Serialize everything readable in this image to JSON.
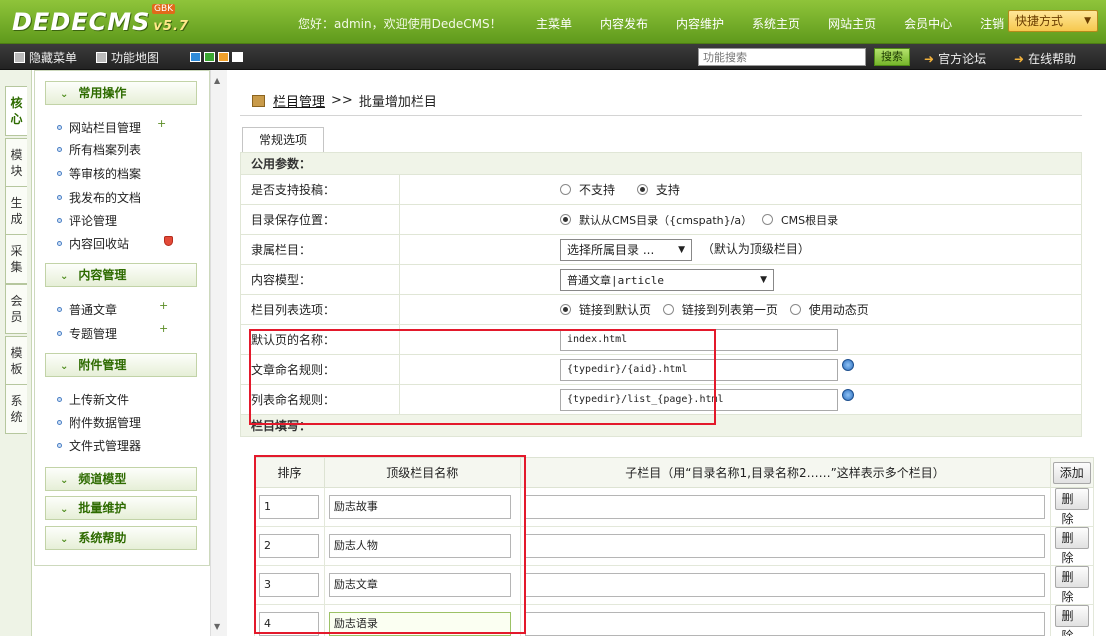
{
  "header": {
    "logo": "DEDECMS",
    "version": "v5.7",
    "badge": "GBK",
    "welcome": "您好：admin，欢迎使用DedeCMS！",
    "nav": [
      "主菜单",
      "内容发布",
      "内容维护",
      "系统主页",
      "网站主页",
      "会员中心"
    ],
    "logout": "注销",
    "quick": "快捷方式"
  },
  "toolbar": {
    "menu_toggle": "隐藏菜单",
    "func_map": "功能地图",
    "search_placeholder": "功能搜索",
    "search_btn": "搜索",
    "forum": "官方论坛",
    "help": "在线帮助",
    "colors": [
      "#2f8bd8",
      "#3aa631",
      "#f0a02a",
      "#ffffff"
    ]
  },
  "vtabs": [
    "核心",
    "模块",
    "生成",
    "采集",
    "会员",
    "模板",
    "系统"
  ],
  "menu": {
    "groups": [
      {
        "title": "常用操作",
        "items": [
          "网站栏目管理",
          "所有档案列表",
          "等审核的档案",
          "我发布的文档",
          "评论管理",
          "内容回收站"
        ]
      },
      {
        "title": "内容管理",
        "items": [
          "普通文章",
          "专题管理"
        ]
      },
      {
        "title": "附件管理",
        "items": [
          "上传新文件",
          "附件数据管理",
          "文件式管理器"
        ]
      },
      {
        "title": "频道模型",
        "items": []
      },
      {
        "title": "批量维护",
        "items": []
      },
      {
        "title": "系统帮助",
        "items": []
      }
    ],
    "add_mark": "+"
  },
  "crumb": {
    "link": "栏目管理",
    "sep": ">>",
    "current": "批量增加栏目"
  },
  "tab": "常规选项",
  "form": {
    "section_public": "公用参数：",
    "browse_label": "是否支持投稿：",
    "browse_opts": [
      "不支持",
      "支持"
    ],
    "path_label": "目录保存位置：",
    "path_opts": [
      "默认从CMS目录（{cmspath}/a）",
      "CMS根目录"
    ],
    "parent_label": "隶属栏目：",
    "parent_value": "选择所属目录 ...",
    "parent_hint": "（默认为顶级栏目）",
    "model_label": "内容模型：",
    "model_value": "普通文章|article",
    "list_label": "栏目列表选项：",
    "list_opts": [
      "链接到默认页",
      "链接到列表第一页",
      "使用动态页"
    ],
    "default_label": "默认页的名称：",
    "default_value": "index.html",
    "article_label": "文章命名规则：",
    "article_value": "{typedir}/{aid}.html",
    "listrule_label": "列表命名规则：",
    "listrule_value": "{typedir}/list_{page}.html",
    "section_columns": "栏目填写："
  },
  "columns": {
    "head_order": "排序",
    "head_name": "顶级栏目名称",
    "head_sub": "子栏目（用“目录名称1,目录名称2……”这样表示多个栏目）",
    "add_btn": "添加",
    "del_btn": "删除",
    "rows": [
      {
        "order": "1",
        "name": "励志故事",
        "sub": ""
      },
      {
        "order": "2",
        "name": "励志人物",
        "sub": ""
      },
      {
        "order": "3",
        "name": "励志文章",
        "sub": ""
      },
      {
        "order": "4",
        "name": "励志语录",
        "sub": ""
      }
    ]
  }
}
